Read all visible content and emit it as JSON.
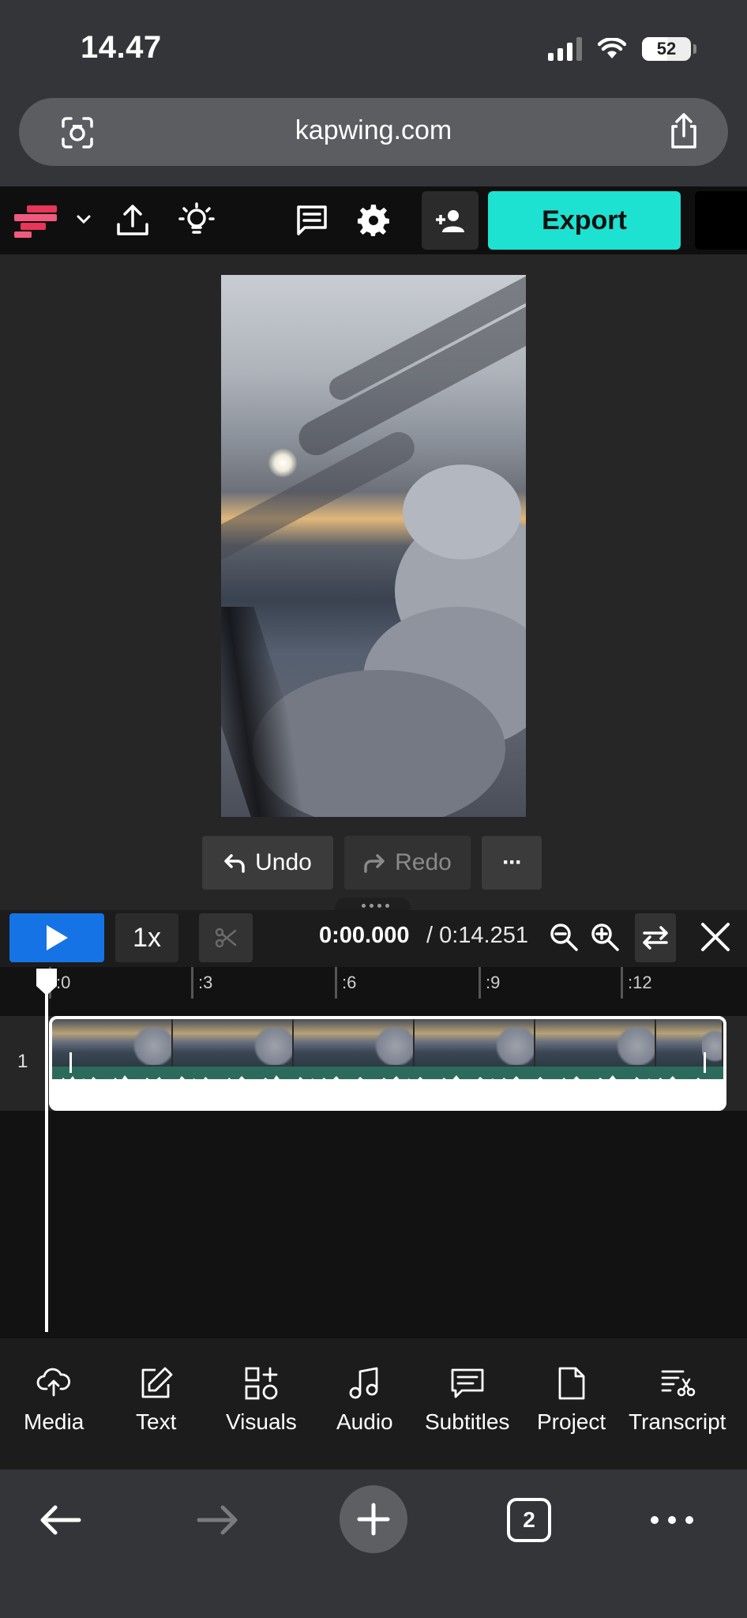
{
  "status_bar": {
    "time": "14.47",
    "battery": "52"
  },
  "browser": {
    "url": "kapwing.com",
    "tab_count": "2"
  },
  "toolbar": {
    "export_label": "Export"
  },
  "editor": {
    "undo_label": "Undo",
    "redo_label": "Redo",
    "more_label": "···"
  },
  "timeline": {
    "speed": "1x",
    "current_time": "0:00.000",
    "total_time": "/ 0:14.251",
    "ticks": [
      ":0",
      ":3",
      ":6",
      ":9",
      ":12"
    ],
    "track_number": "1"
  },
  "tools": [
    {
      "label": "Media",
      "icon": "upload-cloud-icon"
    },
    {
      "label": "Text",
      "icon": "edit-text-icon"
    },
    {
      "label": "Visuals",
      "icon": "shapes-plus-icon"
    },
    {
      "label": "Audio",
      "icon": "music-note-icon"
    },
    {
      "label": "Subtitles",
      "icon": "subtitles-icon"
    },
    {
      "label": "Project",
      "icon": "document-icon"
    },
    {
      "label": "Transcript",
      "icon": "transcript-scissors-icon"
    }
  ],
  "colors": {
    "accent": "#1de1d1",
    "play": "#1573e6",
    "brand_a": "#e8355a",
    "brand_b": "#f05a7e"
  }
}
